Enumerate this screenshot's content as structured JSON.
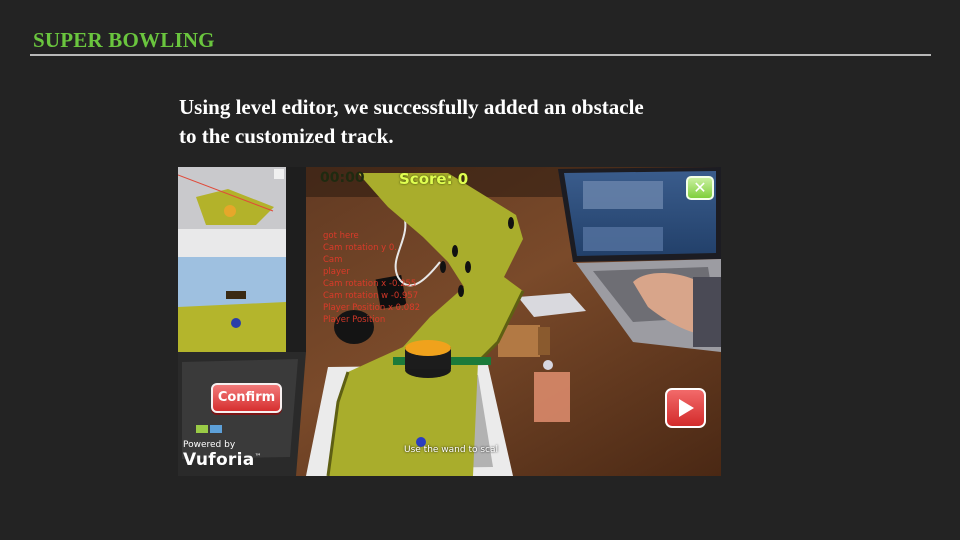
{
  "slide": {
    "title": "SUPER BOWLING",
    "caption_line1": "Using level editor, we successfully added an obstacle",
    "caption_line2": "to the customized track."
  },
  "screenshot": {
    "hud": {
      "timer": "00:00",
      "score": "Score: 0"
    },
    "debug_text": "got here\nCam rotation y 0.\nCam\nplayer\nCam rotation x -0.255\nCam rotation w -0.957\nPlayer Position x 0.082\nPlayer Position",
    "buttons": {
      "confirm_label": "Confirm",
      "close_icon": "close-icon",
      "play_icon": "play-icon"
    },
    "branding": {
      "powered_by": "Powered by",
      "vuforia": "Vuforia",
      "trademark": "™"
    },
    "hint": "Use the wand to scal"
  },
  "colors": {
    "background": "#232323",
    "title": "#6ac53e",
    "rule": "#b8b8b8",
    "track": "#a9ad2c",
    "button_red": "#d62f2f",
    "button_green": "#7fcf3c"
  }
}
